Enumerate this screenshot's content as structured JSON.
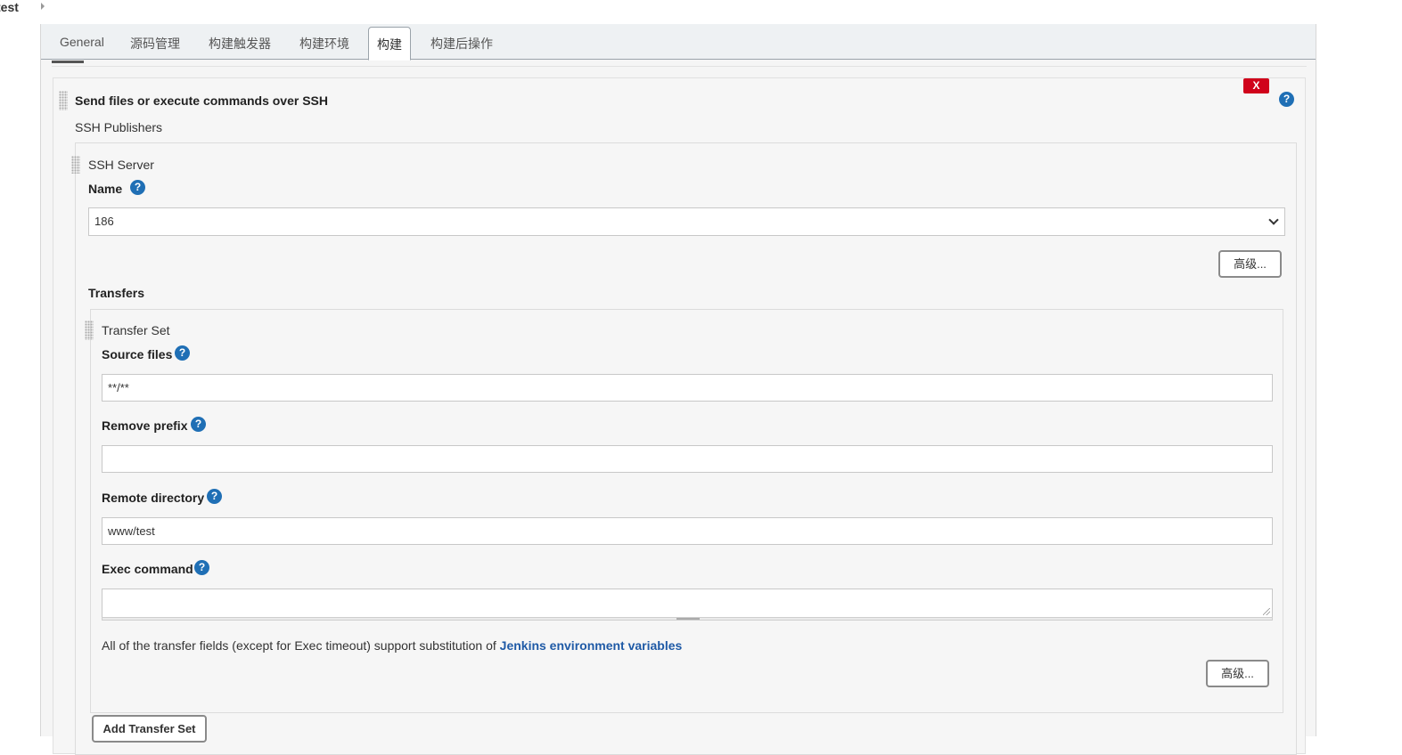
{
  "breadcrumb": {
    "label": "test"
  },
  "tabs": [
    {
      "label": "General"
    },
    {
      "label": "源码管理"
    },
    {
      "label": "构建触发器"
    },
    {
      "label": "构建环境"
    },
    {
      "label": "构建"
    },
    {
      "label": "构建后操作"
    }
  ],
  "active_tab": "构建",
  "step": {
    "title": "Send files or execute commands over SSH",
    "delete_label": "X",
    "help_label": "?",
    "publishers_label": "SSH Publishers",
    "server": {
      "heading": "SSH Server",
      "name_label": "Name",
      "name_value": "186",
      "advanced_label": "高级..."
    },
    "transfers_label": "Transfers",
    "transfer_set": {
      "heading": "Transfer Set",
      "source_files_label": "Source files",
      "source_files_value": "**/**",
      "remove_prefix_label": "Remove prefix",
      "remove_prefix_value": "",
      "remote_directory_label": "Remote directory",
      "remote_directory_value": "www/test",
      "exec_command_label": "Exec command",
      "exec_command_value": "",
      "note_text": "All of the transfer fields (except for Exec timeout) support substitution of ",
      "note_link": "Jenkins environment variables",
      "advanced_label": "高级..."
    },
    "add_transfer_set_label": "Add Transfer Set"
  },
  "colors": {
    "help": "#1f6fb5",
    "delete": "#d0021b",
    "link": "#1f5aa6"
  }
}
